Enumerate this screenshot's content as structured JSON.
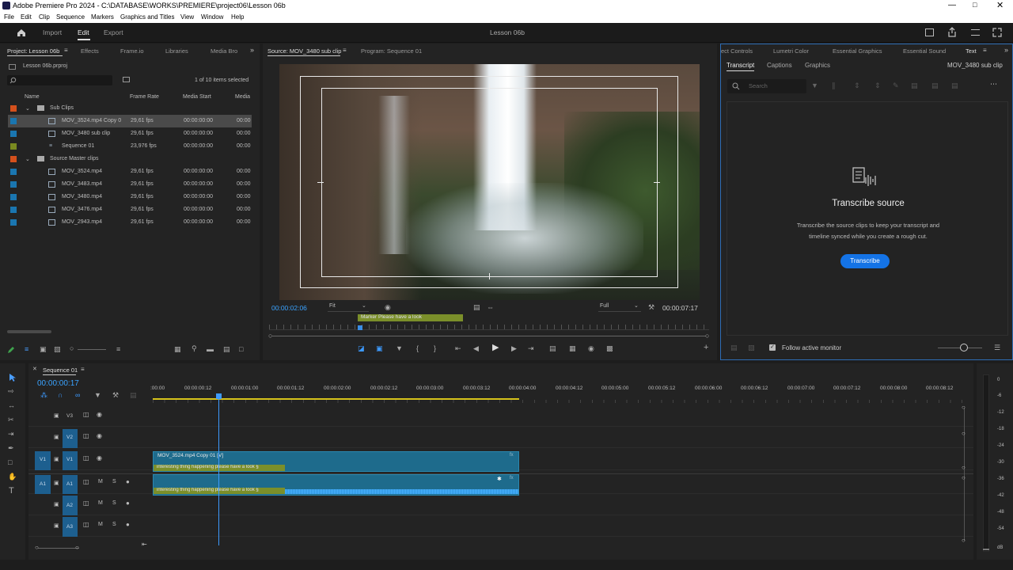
{
  "titlebar": {
    "title": "Adobe Premiere Pro 2024 - C:\\DATABASE\\WORKS\\PREMIERE\\project06\\Lesson 06b"
  },
  "menu": [
    "File",
    "Edit",
    "Clip",
    "Sequence",
    "Markers",
    "Graphics and Titles",
    "View",
    "Window",
    "Help"
  ],
  "workspace": {
    "import": "Import",
    "edit": "Edit",
    "export": "Export",
    "doc_title": "Lesson 06b"
  },
  "project": {
    "tabs": [
      "Project: Lesson 06b",
      "Effects",
      "Frame.io",
      "Libraries",
      "Media Bro"
    ],
    "file": "Lesson 06b.prproj",
    "items_count": "1 of 10 items selected",
    "columns": [
      "Name",
      "Frame Rate",
      "Media Start",
      "Media"
    ],
    "rows": [
      {
        "name": "Sub Clips",
        "fps": "",
        "start": "",
        "color": "#d4501c"
      },
      {
        "name": "MOV_3524.mp4 Copy 0",
        "fps": "29,61 fps",
        "start": "00:00:00:00",
        "extra": "00:00",
        "color": "#1a76b0"
      },
      {
        "name": "MOV_3480 sub clip",
        "fps": "29,61 fps",
        "start": "00:00:00:00",
        "extra": "00:00",
        "color": "#1a76b0"
      },
      {
        "name": "Sequence 01",
        "fps": "23,976 fps",
        "start": "00:00:00:00",
        "extra": "00:00",
        "color": "#7a8a20"
      },
      {
        "name": "Source Master clips",
        "fps": "",
        "start": "",
        "color": "#d4501c"
      },
      {
        "name": "MOV_3524.mp4",
        "fps": "29,61 fps",
        "start": "00:00:00:00",
        "extra": "00:00",
        "color": "#1a76b0"
      },
      {
        "name": "MOV_3483.mp4",
        "fps": "29,61 fps",
        "start": "00:00:00:00",
        "extra": "00:00",
        "color": "#1a76b0"
      },
      {
        "name": "MOV_3480.mp4",
        "fps": "29,61 fps",
        "start": "00:00:00:00",
        "extra": "00:00",
        "color": "#1a76b0"
      },
      {
        "name": "MOV_3476.mp4",
        "fps": "29,61 fps",
        "start": "00:00:00:00",
        "extra": "00:00",
        "color": "#1a76b0"
      },
      {
        "name": "MOV_2943.mp4",
        "fps": "29,61 fps",
        "start": "00:00:00:00",
        "extra": "00:00",
        "color": "#1a76b0"
      }
    ]
  },
  "source": {
    "tab_source": "Source: MOV_3480 sub clip",
    "tab_program": "Program: Sequence 01",
    "timecode_in": "00:00:02:06",
    "fit": "Fit",
    "quality": "Full",
    "timecode_dur": "00:00:07:17",
    "marker": "Marker Please have a look"
  },
  "right": {
    "tabs": [
      "ect Controls",
      "Lumetri Color",
      "Essential Graphics",
      "Essential Sound",
      "Text"
    ],
    "subtabs": [
      "Transcript",
      "Captions",
      "Graphics"
    ],
    "clip": "MOV_3480 sub clip",
    "search_placeholder": "Search",
    "heading": "Transcribe source",
    "desc1": "Transcribe the source clips to keep your transcript and",
    "desc2": "timeline synced while you create a rough cut.",
    "button": "Transcribe",
    "follow": "Follow active monitor"
  },
  "timeline": {
    "tab": "Sequence 01",
    "timecode": "00:00:00:17",
    "ticks": [
      ":00:00",
      "00:00:00:12",
      "00:00:01:00",
      "00:00:01:12",
      "00:00:02:00",
      "00:00:02:12",
      "00:00:03:00",
      "00:00:03:12",
      "00:00:04:00",
      "00:00:04:12",
      "00:00:05:00",
      "00:00:05:12",
      "00:00:06:00",
      "00:00:06:12",
      "00:00:07:00",
      "00:00:07:12",
      "00:00:08:00",
      "00:00:08:12"
    ],
    "tracks_v": [
      "V3",
      "V2",
      "V1"
    ],
    "tracks_a": [
      "A1",
      "A2",
      "A3"
    ],
    "src_v": "V1",
    "src_a": "A1",
    "clip_v": "MOV_3524.mp4 Copy 01 [V]",
    "marker_text": "interesting thing happening please have a look §",
    "fx": "fx"
  },
  "meter": {
    "labels": [
      "0",
      "-6",
      "-12",
      "-18",
      "-24",
      "-30",
      "-36",
      "-42",
      "-48",
      "-54",
      "dB"
    ]
  }
}
